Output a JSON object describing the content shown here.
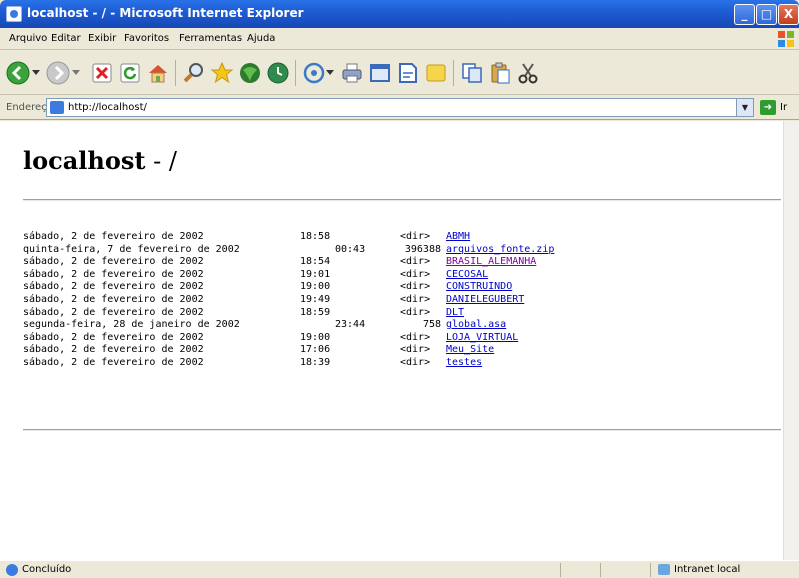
{
  "window": {
    "title": "localhost - / - Microsoft Internet Explorer",
    "min_label": "_",
    "max_label": "□",
    "close_label": "X"
  },
  "menu": [
    "Arquivo",
    "Editar",
    "Exibir",
    "Favoritos",
    "Ferramentas",
    "Ajuda"
  ],
  "toolbar": {
    "icons": [
      "back-icon",
      "back-dropdown-icon",
      "forward-icon",
      "forward-dropdown-icon",
      "stop-icon",
      "refresh-icon",
      "home-icon",
      "search-icon",
      "favorites-icon",
      "media-icon",
      "history-icon",
      "mail-icon",
      "mail-dropdown-icon",
      "print-icon",
      "edit-icon",
      "discuss-icon",
      "messenger-icon",
      "copy-icon",
      "paste-icon",
      "cut-icon"
    ]
  },
  "address": {
    "label": "Endereço",
    "url": "http://localhost/",
    "go_label": "Ir"
  },
  "page": {
    "title_host": "localhost",
    "title_path": " - /"
  },
  "listing": [
    {
      "date": "sábado, 2 de fevereiro de 2002",
      "time": "18:58",
      "size": "<dir>",
      "name": "ABMH",
      "visited": false,
      "long": false
    },
    {
      "date": "quinta-feira, 7 de fevereiro de 2002",
      "time": "00:43",
      "size": "396388",
      "name": "arquivos_fonte.zip",
      "visited": false,
      "long": true
    },
    {
      "date": "sábado, 2 de fevereiro de 2002",
      "time": "18:54",
      "size": "<dir>",
      "name": "BRASIL_ALEMANHA",
      "visited": true,
      "long": false
    },
    {
      "date": "sábado, 2 de fevereiro de 2002",
      "time": "19:01",
      "size": "<dir>",
      "name": "CECOSAL",
      "visited": false,
      "long": false
    },
    {
      "date": "sábado, 2 de fevereiro de 2002",
      "time": "19:00",
      "size": "<dir>",
      "name": "CONSTRUINDO",
      "visited": false,
      "long": false
    },
    {
      "date": "sábado, 2 de fevereiro de 2002",
      "time": "19:49",
      "size": "<dir>",
      "name": "DANIELEGUBERT",
      "visited": false,
      "long": false
    },
    {
      "date": "sábado, 2 de fevereiro de 2002",
      "time": "18:59",
      "size": "<dir>",
      "name": "DLT",
      "visited": false,
      "long": false
    },
    {
      "date": "segunda-feira, 28 de janeiro de 2002",
      "time": "23:44",
      "size": "758",
      "name": "global.asa",
      "visited": false,
      "long": true
    },
    {
      "date": "sábado, 2 de fevereiro de 2002",
      "time": "19:00",
      "size": "<dir>",
      "name": "LOJA_VIRTUAL",
      "visited": false,
      "long": false
    },
    {
      "date": "sábado, 2 de fevereiro de 2002",
      "time": "17:06",
      "size": "<dir>",
      "name": "Meu_Site",
      "visited": false,
      "long": false
    },
    {
      "date": "sábado, 2 de fevereiro de 2002",
      "time": "18:39",
      "size": "<dir>",
      "name": "testes",
      "visited": false,
      "long": false
    }
  ],
  "status": {
    "text": "Concluído",
    "zone": "Intranet local"
  }
}
